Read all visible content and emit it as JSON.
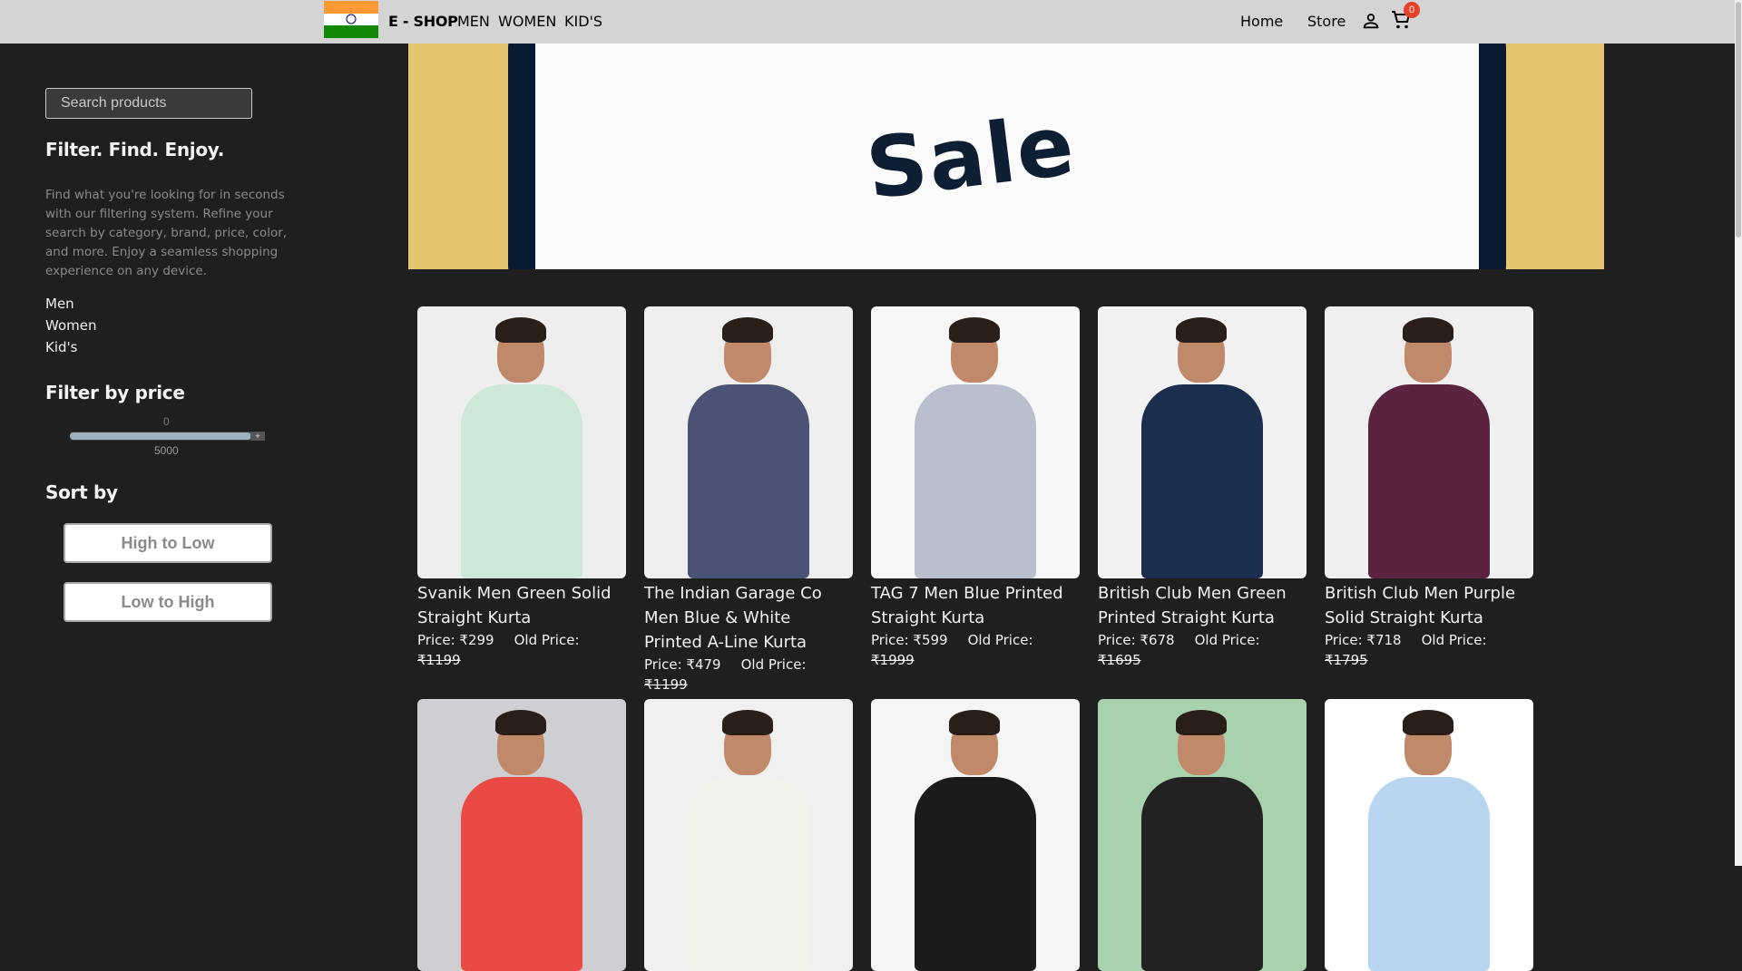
{
  "navbar": {
    "brand": "E - SHOP",
    "links": [
      "MEN",
      "WOMEN",
      "KID'S"
    ],
    "right_links": [
      "Home",
      "Store"
    ],
    "cart_count": "0"
  },
  "sidebar": {
    "search_placeholder": "Search products",
    "title": "Filter. Find. Enjoy.",
    "description": "Find what you're looking for in seconds with our filtering system. Refine your search by category, brand, price, color, and more. Enjoy a seamless shopping experience on any device.",
    "categories": [
      "Men",
      "Women",
      "Kid's"
    ],
    "price_title": "Filter by price",
    "price_min": "0",
    "price_max": "5000",
    "price_fraction": 0.93,
    "sort_title": "Sort by",
    "sort_options": [
      "High to Low",
      "Low to High"
    ]
  },
  "banner": {
    "text": "Sale"
  },
  "products": [
    {
      "title": "Svanik Men Green Solid Straight Kurta",
      "price": "Price: ₹299",
      "old_label": "Old Price:",
      "old_price": "₹1199",
      "color": "#cde7d9",
      "bg": "#eeeeee"
    },
    {
      "title": "The Indian Garage Co Men Blue & White Printed A-Line Kurta",
      "price": "Price: ₹479",
      "old_label": "Old Price:",
      "old_price": "₹1199",
      "color": "#4a5275",
      "bg": "#efefef"
    },
    {
      "title": "TAG 7 Men Blue Printed Straight Kurta",
      "price": "Price: ₹599",
      "old_label": "Old Price:",
      "old_price": "₹1999",
      "color": "#b9bfcc",
      "bg": "#f7f7f7"
    },
    {
      "title": "British Club Men Green Printed Straight Kurta",
      "price": "Price: ₹678",
      "old_label": "Old Price:",
      "old_price": "₹1695",
      "color": "#1c2e4e",
      "bg": "#f2f2f2"
    },
    {
      "title": "British Club Men Purple Solid Straight Kurta",
      "price": "Price: ₹718",
      "old_label": "Old Price:",
      "old_price": "₹1795",
      "color": "#5b2340",
      "bg": "#efefef"
    }
  ],
  "products_row2": [
    {
      "color": "#e94b44",
      "bg": "#cfcfd3"
    },
    {
      "color": "#f1f2ec",
      "bg": "#f0f0f0"
    },
    {
      "color": "#1b1b1b",
      "bg": "#f5f5f5"
    },
    {
      "color": "#222222",
      "bg": "#a8d1ad"
    },
    {
      "color": "#b8d6f0",
      "bg": "#ffffff"
    }
  ]
}
